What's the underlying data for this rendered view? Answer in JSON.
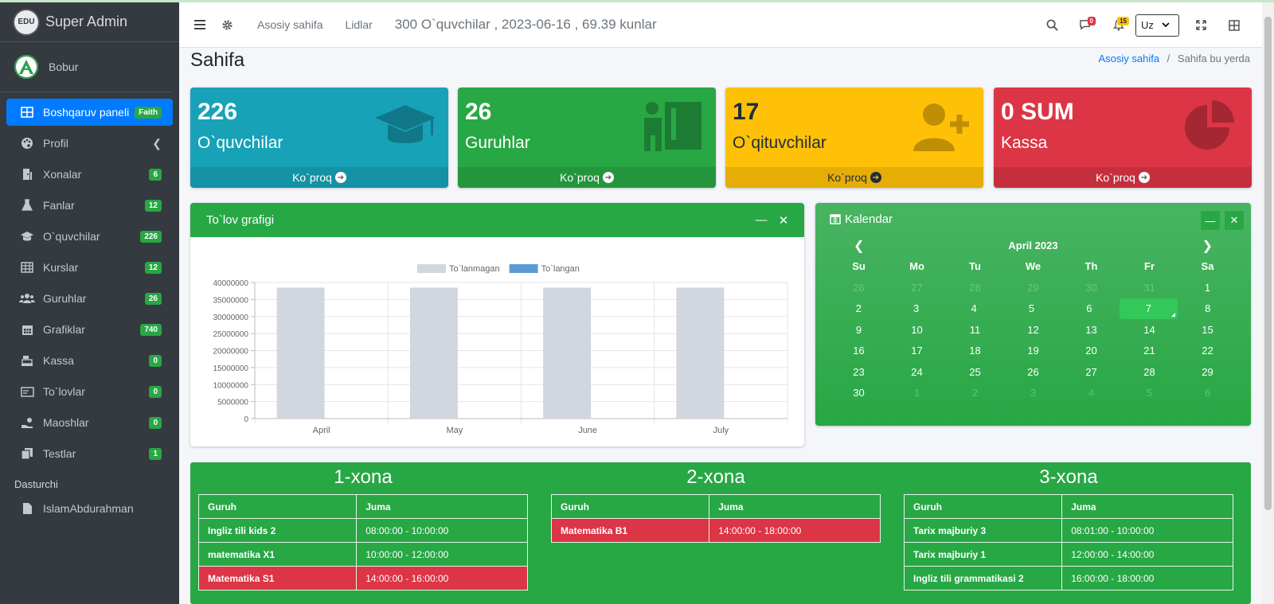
{
  "brand": {
    "logo_text": "EDU",
    "title": "Super Admin"
  },
  "user": {
    "name": "Bobur"
  },
  "sidebar": {
    "items": [
      {
        "label": "Boshqaruv paneli",
        "badge": "Faith",
        "icon": "dashboard-icon",
        "active": true
      },
      {
        "label": "Profil",
        "badge": "",
        "icon": "palette-icon",
        "chevron": true
      },
      {
        "label": "Xonalar",
        "badge": "6",
        "icon": "door-icon"
      },
      {
        "label": "Fanlar",
        "badge": "12",
        "icon": "flask-icon"
      },
      {
        "label": "O`quvchilar",
        "badge": "226",
        "icon": "graduation-cap-icon"
      },
      {
        "label": "Kurslar",
        "badge": "12",
        "icon": "table-icon"
      },
      {
        "label": "Guruhlar",
        "badge": "26",
        "icon": "users-icon"
      },
      {
        "label": "Grafiklar",
        "badge": "740",
        "icon": "calendar-icon"
      },
      {
        "label": "Kassa",
        "badge": "0",
        "icon": "cash-register-icon"
      },
      {
        "label": "To`lovlar",
        "badge": "0",
        "icon": "money-check-icon"
      },
      {
        "label": "Maoshlar",
        "badge": "0",
        "icon": "hand-money-icon"
      },
      {
        "label": "Testlar",
        "badge": "1",
        "icon": "copy-icon"
      }
    ],
    "header": "Dasturchi",
    "dev_item": {
      "label": "IslamAbdurahman",
      "icon": "file-icon"
    }
  },
  "navbar": {
    "links": [
      "Asosiy sahifa",
      "Lidlar"
    ],
    "info": "300 O`quvchilar , 2023-06-16 , 69.39 kunlar",
    "messages_count": "0",
    "notifications_count": "15",
    "language": "Uz"
  },
  "page": {
    "title": "Sahifa",
    "breadcrumb_home": "Asosiy sahifa",
    "breadcrumb_current": "Sahifa bu yerda"
  },
  "stats": [
    {
      "value": "226",
      "label": "O`quvchilar",
      "more": "Ko`proq",
      "color": "#17a2b8",
      "icon": "graduation-cap-icon"
    },
    {
      "value": "26",
      "label": "Guruhlar",
      "more": "Ko`proq",
      "color": "#28a745",
      "icon": "chalkboard-teacher-icon"
    },
    {
      "value": "17",
      "label": "O`qituvchilar",
      "more": "Ko`proq",
      "color": "#ffc107",
      "icon": "user-plus-icon"
    },
    {
      "value": "0 SUM",
      "label": "Kassa",
      "more": "Ko`proq",
      "color": "#dc3545",
      "icon": "pie-chart-icon"
    }
  ],
  "chart_card": {
    "title": "To`lov grafigi"
  },
  "chart_data": {
    "type": "bar",
    "categories": [
      "April",
      "May",
      "June",
      "July"
    ],
    "series": [
      {
        "name": "To`lanmagan",
        "values": [
          38500000,
          38500000,
          38500000,
          38500000
        ],
        "color": "#d2d6de"
      },
      {
        "name": "To`langan",
        "values": [
          0,
          0,
          0,
          0
        ],
        "color": "#5b9bd5"
      }
    ],
    "yticks": [
      0,
      5000000,
      10000000,
      15000000,
      20000000,
      25000000,
      30000000,
      35000000,
      40000000
    ],
    "ylim": [
      0,
      40000000
    ],
    "grid": true,
    "legend": "top"
  },
  "calendar": {
    "title": "Kalendar",
    "month": "April 2023",
    "weekdays": [
      "Su",
      "Mo",
      "Tu",
      "We",
      "Th",
      "Fr",
      "Sa"
    ],
    "weeks": [
      [
        "26",
        "27",
        "28",
        "29",
        "30",
        "31",
        "1"
      ],
      [
        "2",
        "3",
        "4",
        "5",
        "6",
        "7",
        "8"
      ],
      [
        "9",
        "10",
        "11",
        "12",
        "13",
        "14",
        "15"
      ],
      [
        "16",
        "17",
        "18",
        "19",
        "20",
        "21",
        "22"
      ],
      [
        "23",
        "24",
        "25",
        "26",
        "27",
        "28",
        "29"
      ],
      [
        "30",
        "1",
        "2",
        "3",
        "4",
        "5",
        "6"
      ]
    ],
    "today": "7"
  },
  "rooms": [
    {
      "title": "1-xona",
      "headers": [
        "Guruh",
        "Juma"
      ],
      "rows": [
        {
          "group": "Ingliz tili kids 2",
          "time": "08:00:00 - 10:00:00",
          "alert": false
        },
        {
          "group": "matematika X1",
          "time": "10:00:00 - 12:00:00",
          "alert": false
        },
        {
          "group": "Matematika S1",
          "time": "14:00:00 - 16:00:00",
          "alert": true
        }
      ]
    },
    {
      "title": "2-xona",
      "headers": [
        "Guruh",
        "Juma"
      ],
      "rows": [
        {
          "group": "Matematika B1",
          "time": "14:00:00 - 18:00:00",
          "alert": true
        }
      ]
    },
    {
      "title": "3-xona",
      "headers": [
        "Guruh",
        "Juma"
      ],
      "rows": [
        {
          "group": "Tarix majburiy 3",
          "time": "08:01:00 - 10:00:00",
          "alert": false
        },
        {
          "group": "Tarix majburiy 1",
          "time": "12:00:00 - 14:00:00",
          "alert": false
        },
        {
          "group": "Ingliz tili grammatikasi 2",
          "time": "16:00:00 - 18:00:00",
          "alert": false
        }
      ]
    }
  ]
}
